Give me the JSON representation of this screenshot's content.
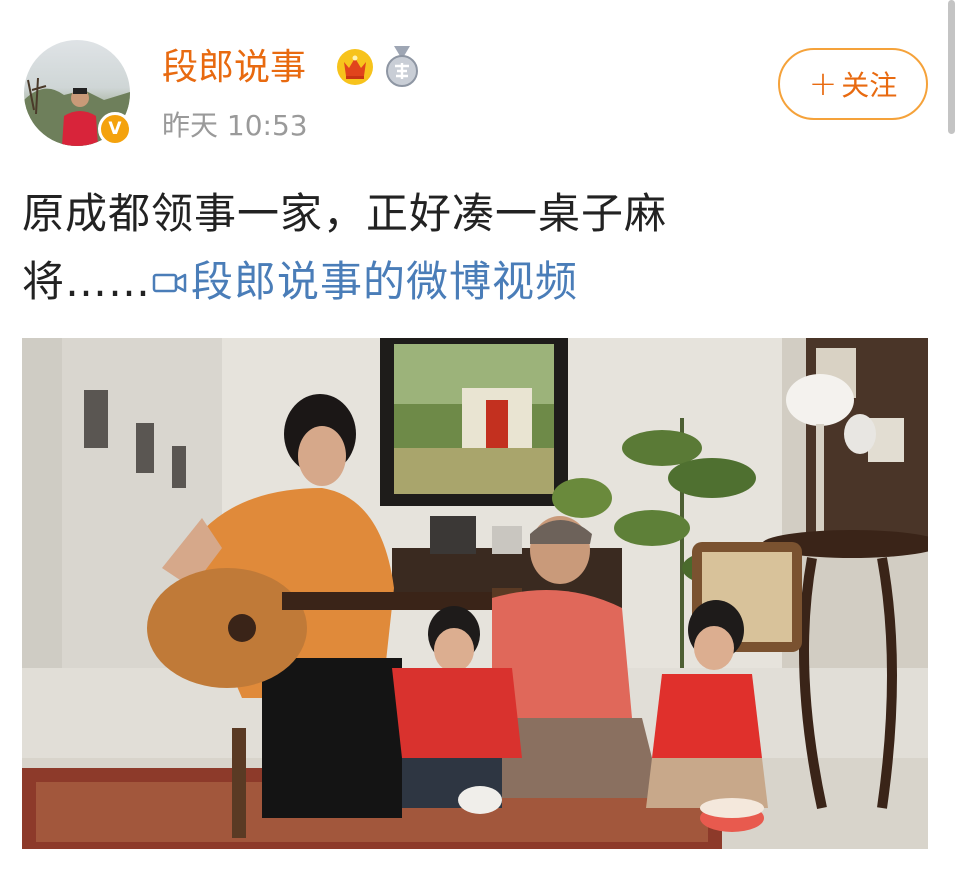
{
  "author": {
    "name": "段郎说事",
    "verified_badge": "V",
    "post_time": "昨天 10:53"
  },
  "icons": {
    "crown": "crown-icon",
    "medal": "medal-icon",
    "camera": "video-camera-icon"
  },
  "follow_button": {
    "plus": "+",
    "label": "关注"
  },
  "post": {
    "line1": "原成都领事一家，正好凑一桌子麻",
    "line2_prefix": "将……",
    "video_link": "段郎说事的微博视频"
  },
  "colors": {
    "name": "#e86a10",
    "link": "#4a7db8",
    "follow_border": "#f5a23a",
    "verified": "#f4a20d",
    "time": "#9a9a9a"
  }
}
